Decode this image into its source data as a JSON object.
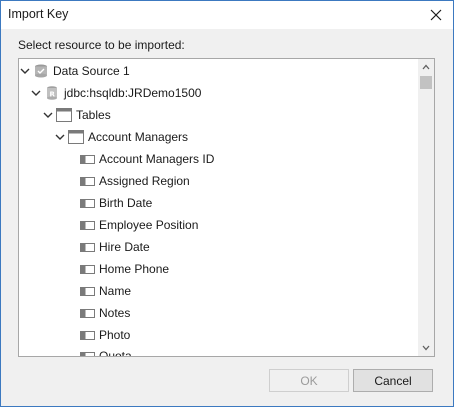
{
  "window": {
    "title": "Import Key",
    "close_icon": "close-icon"
  },
  "prompt": "Select resource to be imported:",
  "tree": {
    "datasource": {
      "label": "Data Source 1",
      "icon": "database-icon",
      "expanded": true
    },
    "connection": {
      "label": "jdbc:hsqldb:JRDemo1500",
      "icon": "connection-database-icon",
      "expanded": true
    },
    "tables": {
      "label": "Tables",
      "icon": "folder-table-icon",
      "expanded": true
    },
    "table": {
      "label": "Account Managers",
      "icon": "table-icon",
      "expanded": true
    },
    "columns": [
      {
        "label": "Account Managers ID"
      },
      {
        "label": "Assigned Region"
      },
      {
        "label": "Birth Date"
      },
      {
        "label": "Employee Position"
      },
      {
        "label": "Hire Date"
      },
      {
        "label": "Home Phone"
      },
      {
        "label": "Name"
      },
      {
        "label": "Notes"
      },
      {
        "label": "Photo"
      },
      {
        "label": "Quota"
      }
    ]
  },
  "buttons": {
    "ok": "OK",
    "cancel": "Cancel"
  }
}
